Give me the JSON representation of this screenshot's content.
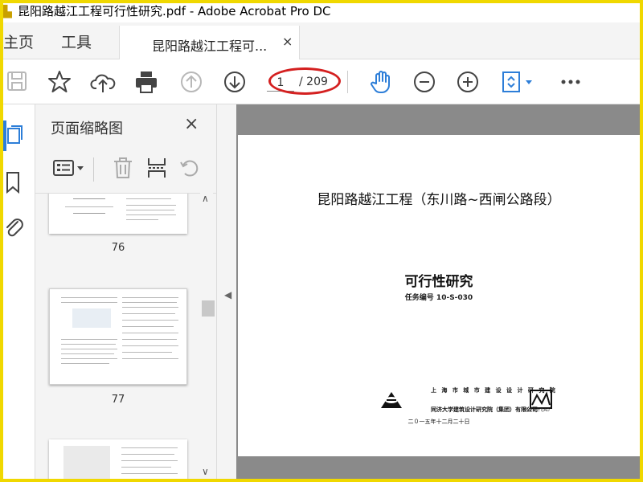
{
  "window": {
    "title": "昆阳路越江工程可行性研究.pdf - Adobe Acrobat Pro DC"
  },
  "tabs": {
    "home": "主页",
    "tools": "工具",
    "document": "昆阳路越江工程可...",
    "close_glyph": "×"
  },
  "toolbar": {
    "page_current": "1",
    "page_total": "/ 209",
    "icons": [
      "save-icon",
      "bookmark-star-icon",
      "upload-cloud-icon",
      "print-icon",
      "prev-page-icon",
      "next-page-icon",
      "hand-tool-icon",
      "zoom-out-icon",
      "zoom-in-icon",
      "fit-page-icon",
      "more-icon"
    ],
    "highlight_color": "#d42020",
    "accent_color": "#2d7ed8"
  },
  "sidebar": {
    "panel_title": "页面缩略图",
    "close_glyph": "×",
    "rail_icons": [
      "pages-icon",
      "bookmark-icon",
      "attachment-icon"
    ],
    "thumbnails": [
      {
        "label": "76"
      },
      {
        "label": "77"
      },
      {
        "label": ""
      }
    ]
  },
  "document": {
    "title": "昆阳路越江工程（东川路~西闸公路段）",
    "subtitle": "可行性研究",
    "task_no": "任务编号 10-S-030",
    "org1": "上 海 市 城 市 建 设 设 计 研 究 院",
    "org2": "同济大学建筑设计研究院（集团）有限公司",
    "date": "二０一五年十二月二十日",
    "logo_right_caption": "同济设计TJAD"
  }
}
